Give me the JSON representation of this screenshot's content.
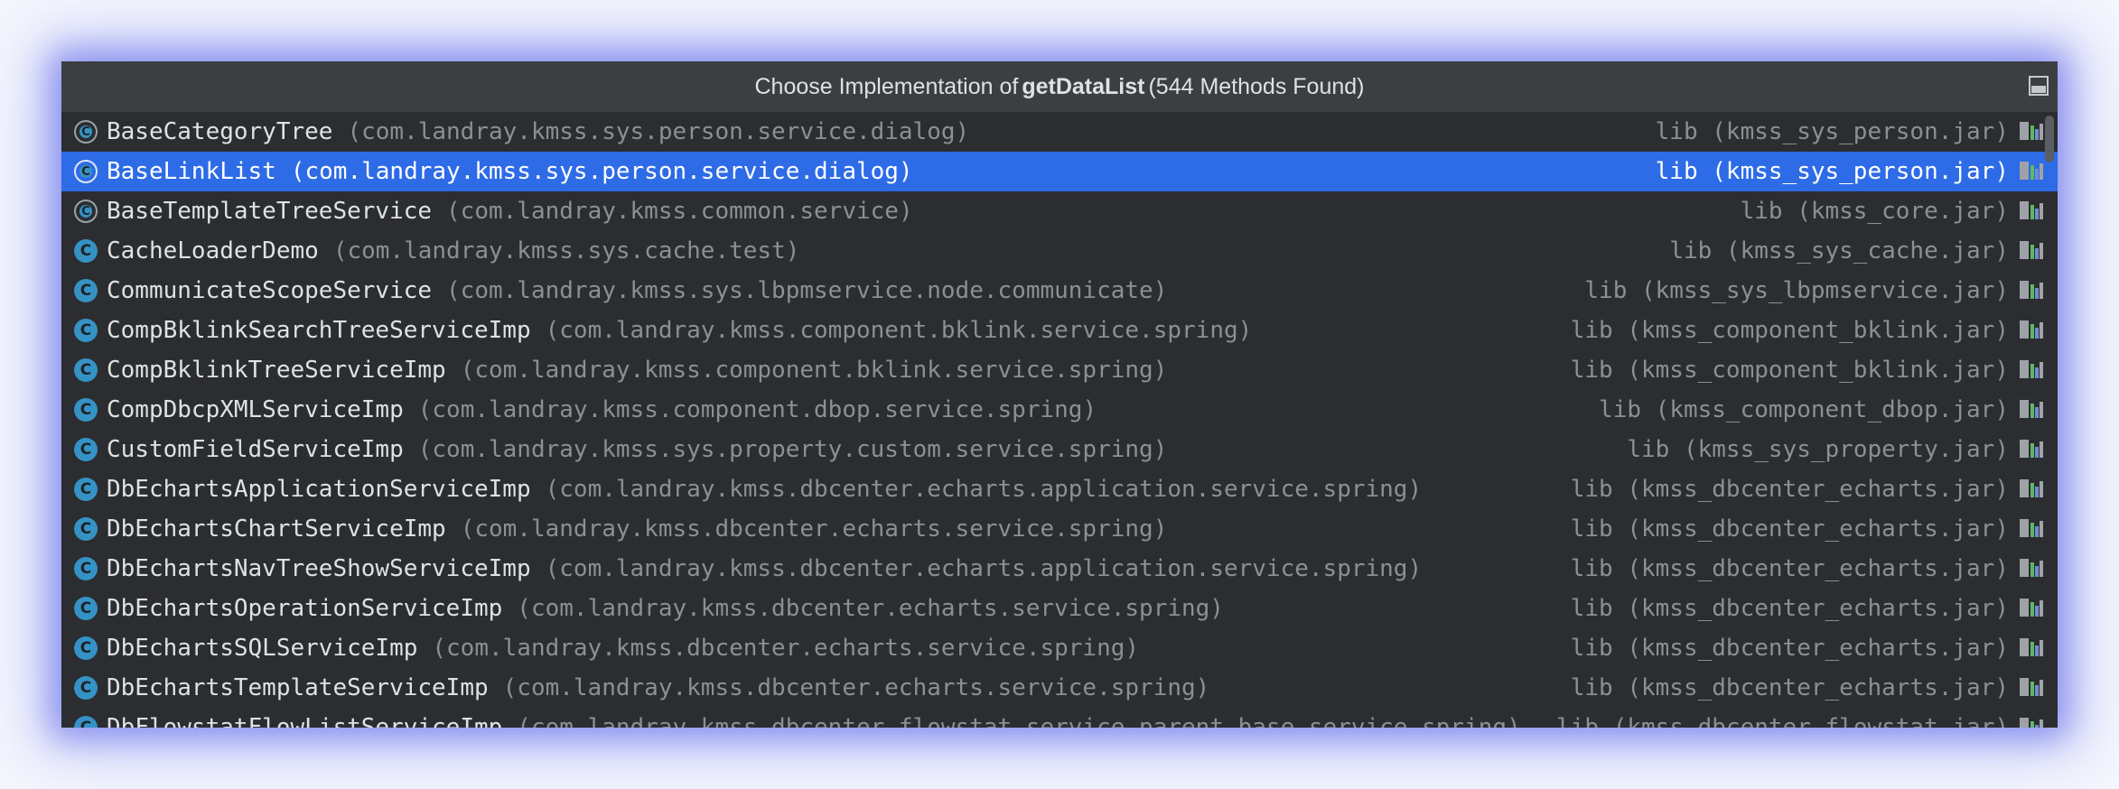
{
  "popup": {
    "title_prefix": "Choose Implementation of",
    "title_method": "getDataList",
    "title_suffix": "(544 Methods Found)"
  },
  "rows": [
    {
      "name": "BaseCategoryTree",
      "pkg": "(com.landray.kmss.sys.person.service.dialog)",
      "lib": "lib (kmss_sys_person.jar)",
      "icon": "abstract-class-icon"
    },
    {
      "name": "BaseLinkList",
      "pkg": "(com.landray.kmss.sys.person.service.dialog)",
      "lib": "lib (kmss_sys_person.jar)",
      "icon": "abstract-class-icon"
    },
    {
      "name": "BaseTemplateTreeService",
      "pkg": "(com.landray.kmss.common.service)",
      "lib": "lib (kmss_core.jar)",
      "icon": "abstract-class-icon"
    },
    {
      "name": "CacheLoaderDemo",
      "pkg": "(com.landray.kmss.sys.cache.test)",
      "lib": "lib (kmss_sys_cache.jar)",
      "icon": "class-icon"
    },
    {
      "name": "CommunicateScopeService",
      "pkg": "(com.landray.kmss.sys.lbpmservice.node.communicate)",
      "lib": "lib (kmss_sys_lbpmservice.jar)",
      "icon": "class-icon"
    },
    {
      "name": "CompBklinkSearchTreeServiceImp",
      "pkg": "(com.landray.kmss.component.bklink.service.spring)",
      "lib": "lib (kmss_component_bklink.jar)",
      "icon": "class-icon"
    },
    {
      "name": "CompBklinkTreeServiceImp",
      "pkg": "(com.landray.kmss.component.bklink.service.spring)",
      "lib": "lib (kmss_component_bklink.jar)",
      "icon": "class-icon"
    },
    {
      "name": "CompDbcpXMLServiceImp",
      "pkg": "(com.landray.kmss.component.dbop.service.spring)",
      "lib": "lib (kmss_component_dbop.jar)",
      "icon": "class-icon"
    },
    {
      "name": "CustomFieldServiceImp",
      "pkg": "(com.landray.kmss.sys.property.custom.service.spring)",
      "lib": "lib (kmss_sys_property.jar)",
      "icon": "class-icon"
    },
    {
      "name": "DbEchartsApplicationServiceImp",
      "pkg": "(com.landray.kmss.dbcenter.echarts.application.service.spring)",
      "lib": "lib (kmss_dbcenter_echarts.jar)",
      "icon": "class-icon"
    },
    {
      "name": "DbEchartsChartServiceImp",
      "pkg": "(com.landray.kmss.dbcenter.echarts.service.spring)",
      "lib": "lib (kmss_dbcenter_echarts.jar)",
      "icon": "class-icon"
    },
    {
      "name": "DbEchartsNavTreeShowServiceImp",
      "pkg": "(com.landray.kmss.dbcenter.echarts.application.service.spring)",
      "lib": "lib (kmss_dbcenter_echarts.jar)",
      "icon": "class-icon"
    },
    {
      "name": "DbEchartsOperationServiceImp",
      "pkg": "(com.landray.kmss.dbcenter.echarts.service.spring)",
      "lib": "lib (kmss_dbcenter_echarts.jar)",
      "icon": "class-icon"
    },
    {
      "name": "DbEchartsSQLServiceImp",
      "pkg": "(com.landray.kmss.dbcenter.echarts.service.spring)",
      "lib": "lib (kmss_dbcenter_echarts.jar)",
      "icon": "class-icon"
    },
    {
      "name": "DbEchartsTemplateServiceImp",
      "pkg": "(com.landray.kmss.dbcenter.echarts.service.spring)",
      "lib": "lib (kmss_dbcenter_echarts.jar)",
      "icon": "class-icon"
    },
    {
      "name": "DbFlowstatFlowListServiceImp",
      "pkg": "(com.landray.kmss.dbcenter.flowstat.service.parent.base.service.spring)",
      "lib": "lib (kmss_dbcenter_flowstat.jar)",
      "icon": "class-icon"
    }
  ]
}
